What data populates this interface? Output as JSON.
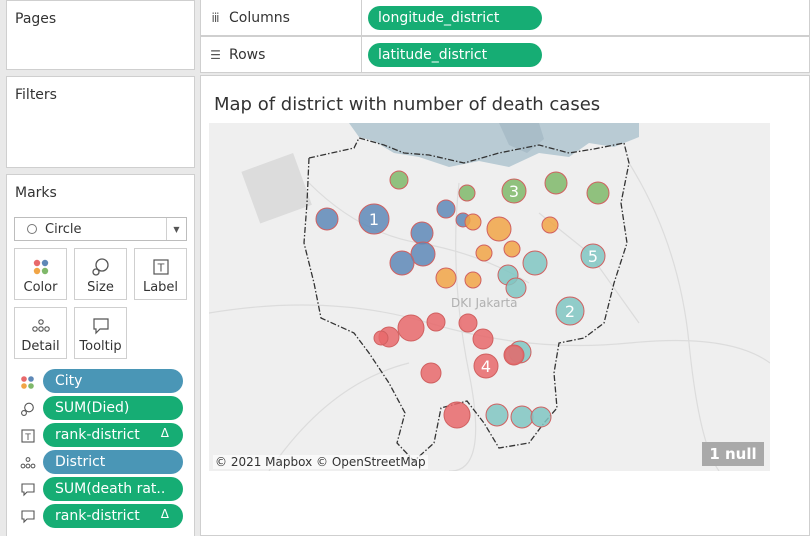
{
  "left_pane": {
    "pages": {
      "title": "Pages"
    },
    "filters": {
      "title": "Filters"
    },
    "marks": {
      "title": "Marks",
      "mark_type": "Circle",
      "buttons": {
        "color": "Color",
        "size": "Size",
        "label": "Label",
        "detail": "Detail",
        "tooltip": "Tooltip"
      },
      "fields": [
        {
          "icon": "color-icon",
          "label": "City",
          "kind": "dimension"
        },
        {
          "icon": "size-icon",
          "label": "SUM(Died)",
          "kind": "measure"
        },
        {
          "icon": "label-icon",
          "label": "rank-district",
          "kind": "measure",
          "delta": "Δ"
        },
        {
          "icon": "detail-icon",
          "label": "District",
          "kind": "dimension"
        },
        {
          "icon": "tooltip-icon",
          "label": "SUM(death rat..",
          "kind": "measure"
        },
        {
          "icon": "tooltip-icon",
          "label": "rank-district",
          "kind": "measure",
          "delta": "Δ"
        }
      ]
    }
  },
  "shelves": {
    "columns": {
      "label": "Columns",
      "pill": "longitude_district"
    },
    "rows": {
      "label": "Rows",
      "pill": "latitude_district"
    }
  },
  "view": {
    "title": "Map of district with number of death cases",
    "map_place_label": "DKI Jakarta",
    "attribution": "© 2021 Mapbox © OpenStreetMap",
    "null_badge": "1 null"
  },
  "colors": {
    "green_city": "#7fb86a",
    "blue_city": "#5e88b7",
    "orange_city": "#f1a546",
    "teal_city": "#80c5c2",
    "red_city": "#e8696b",
    "pill_measure": "#16ad74",
    "pill_dimension": "#4a96b6"
  },
  "map_marks": [
    {
      "city": "green",
      "rank": ""
    },
    {
      "city": "green",
      "rank": ""
    },
    {
      "city": "green",
      "rank": "3"
    },
    {
      "city": "green",
      "rank": ""
    },
    {
      "city": "green",
      "rank": ""
    },
    {
      "city": "blue",
      "rank": ""
    },
    {
      "city": "blue",
      "rank": "1"
    },
    {
      "city": "blue",
      "rank": ""
    },
    {
      "city": "blue",
      "rank": ""
    },
    {
      "city": "blue",
      "rank": ""
    },
    {
      "city": "blue",
      "rank": ""
    },
    {
      "city": "blue",
      "rank": ""
    },
    {
      "city": "orange",
      "rank": ""
    },
    {
      "city": "orange",
      "rank": ""
    },
    {
      "city": "orange",
      "rank": ""
    },
    {
      "city": "orange",
      "rank": ""
    },
    {
      "city": "orange",
      "rank": ""
    },
    {
      "city": "orange",
      "rank": ""
    },
    {
      "city": "orange",
      "rank": ""
    },
    {
      "city": "teal",
      "rank": ""
    },
    {
      "city": "teal",
      "rank": "5"
    },
    {
      "city": "teal",
      "rank": ""
    },
    {
      "city": "teal",
      "rank": ""
    },
    {
      "city": "teal",
      "rank": "2"
    },
    {
      "city": "teal",
      "rank": ""
    },
    {
      "city": "teal",
      "rank": ""
    },
    {
      "city": "teal",
      "rank": ""
    },
    {
      "city": "teal",
      "rank": ""
    },
    {
      "city": "teal",
      "rank": ""
    },
    {
      "city": "red",
      "rank": ""
    },
    {
      "city": "red",
      "rank": ""
    },
    {
      "city": "red",
      "rank": ""
    },
    {
      "city": "red",
      "rank": ""
    },
    {
      "city": "red",
      "rank": ""
    },
    {
      "city": "red",
      "rank": "4"
    },
    {
      "city": "red",
      "rank": ""
    },
    {
      "city": "red",
      "rank": ""
    },
    {
      "city": "red",
      "rank": ""
    },
    {
      "city": "red",
      "rank": ""
    }
  ]
}
